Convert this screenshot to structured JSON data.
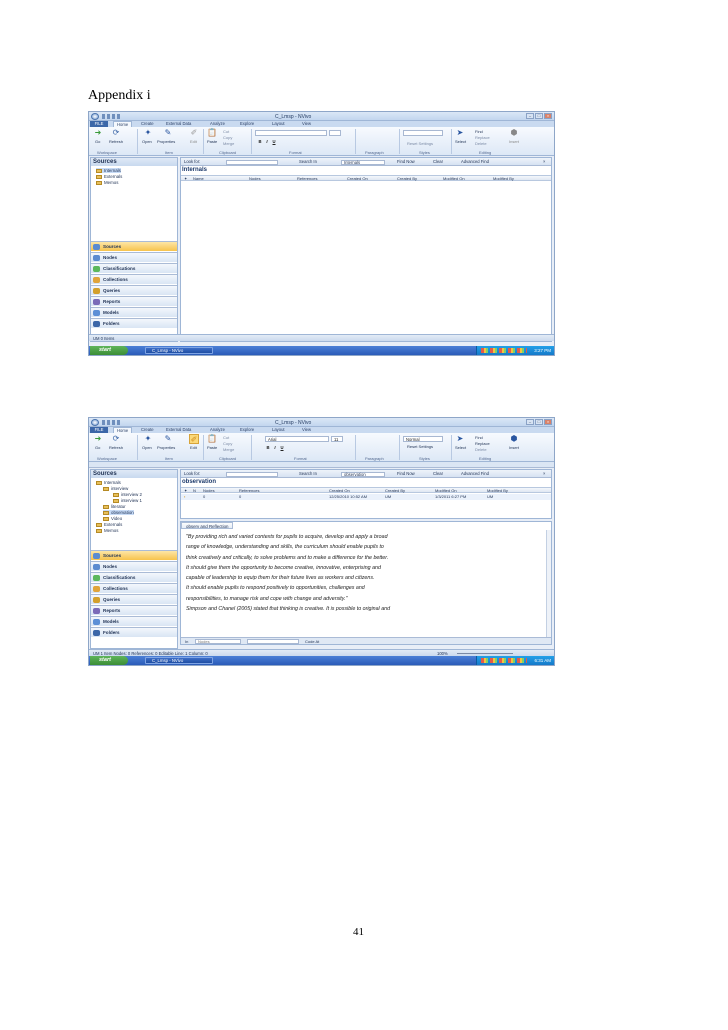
{
  "page": {
    "heading": "Appendix i",
    "page_number": "41"
  },
  "screenshot1": {
    "title": "C_Lmsp - NVivo",
    "tabs": [
      "Home",
      "Create",
      "External Data",
      "Analyze",
      "Explore",
      "Layout",
      "View"
    ],
    "file_tab": "FILE",
    "ribbon": {
      "go": "Go",
      "refresh": "Refresh",
      "open": "Open",
      "properties": "Properties",
      "edit": "Edit",
      "paste": "Paste",
      "cut": "Cut",
      "copy": "Copy",
      "merge": "Merge",
      "reset_settings": "Reset Settings",
      "select": "Select",
      "find": "Find",
      "replace": "Replace",
      "delete": "Delete",
      "insert": "Insert",
      "groups": [
        "Workspace",
        "Item",
        "Clipboard",
        "Format",
        "Paragraph",
        "Styles",
        "Editing"
      ]
    },
    "nav": {
      "header": "Sources",
      "tree": [
        "Internals",
        "Externals",
        "Memos"
      ],
      "buttons": [
        "Sources",
        "Nodes",
        "Classifications",
        "Collections",
        "Queries",
        "Reports",
        "Models",
        "Folders"
      ]
    },
    "find": {
      "look_for": "Look for:",
      "search_in": "Search In",
      "search_value": "Internals",
      "find_now": "Find Now",
      "clear": "Clear",
      "advanced": "Advanced Find"
    },
    "list_title": "Internals",
    "columns": [
      "Name",
      "Nodes",
      "References",
      "Created On",
      "Created By",
      "Modified On",
      "Modified By"
    ],
    "status": "UM   0 Items",
    "taskbar": {
      "start": "start",
      "item": "C_Lmsp - NVivo",
      "clock": "3:27 PM"
    }
  },
  "screenshot2": {
    "title": "C_Lmsp - NVivo",
    "tabs": [
      "Home",
      "Create",
      "External Data",
      "Analyze",
      "Explore",
      "Layout",
      "View"
    ],
    "file_tab": "FILE",
    "ribbon": {
      "go": "Go",
      "refresh": "Refresh",
      "open": "Open",
      "properties": "Properties",
      "edit": "Edit",
      "paste": "Paste",
      "cut": "Cut",
      "copy": "Copy",
      "merge": "Merge",
      "font": "Arial",
      "font_size": "11",
      "style": "Normal",
      "reset_settings": "Reset Settings",
      "select": "Select",
      "find": "Find",
      "replace": "Replace",
      "delete": "Delete",
      "insert": "Insert",
      "groups": [
        "Workspace",
        "Item",
        "Clipboard",
        "Format",
        "Paragraph",
        "Styles",
        "Editing"
      ]
    },
    "nav": {
      "header": "Sources",
      "tree": [
        "Internals",
        "interview",
        "interview 2",
        "interview 1",
        "literatur",
        "observation",
        "Video",
        "Externals",
        "Memos"
      ],
      "buttons": [
        "Sources",
        "Nodes",
        "Classifications",
        "Collections",
        "Queries",
        "Reports",
        "Models",
        "Folders"
      ]
    },
    "find": {
      "look_for": "Look for:",
      "search_in": "Search In",
      "search_value": "observation",
      "find_now": "Find Now",
      "clear": "Clear",
      "advanced": "Advanced Find"
    },
    "list_title": "observation",
    "columns": [
      "N",
      "Nodes",
      "References",
      "Created On",
      "Created By",
      "Modified On",
      "Modified By"
    ],
    "row": {
      "nodes": "0",
      "references": "0",
      "created_on": "12/25/2010 10:52 AM",
      "created_by": "UM",
      "modified_on": "1/3/2011 6:27 PM",
      "modified_by": "UM"
    },
    "detail_tab": "observ and Reflection",
    "detail_lines": [
      "\"By providing rich and varied contexts for pupils to acquire, develop and apply a broad",
      "range of knowledge, understanding and skills, the curriculum should enable pupils to",
      "think creatively and critically, to solve problems and to make a difference for the better.",
      "It should give them the opportunity to become creative, innovative, enterprising and",
      "capable of leadership to equip them for their future lives as workers and citizens.",
      "It should enable pupils to respond positively to opportunities, challenges and",
      "responsibilities, to manage risk and cope with change and adversity.\"",
      "Simpson and Chanel (2005) stated that thinking is creative. It is possible to original and"
    ],
    "detail_footer": {
      "in": "In",
      "nodes": "Nodes",
      "code_at": "Code At"
    },
    "status": "UM   1 Item   Nodes: 0   References: 0    Editable   Line: 1  Column: 0",
    "zoom": "100%",
    "taskbar": {
      "start": "start",
      "item": "C_Lmsp - NVivo",
      "clock": "6:31 AM"
    }
  }
}
